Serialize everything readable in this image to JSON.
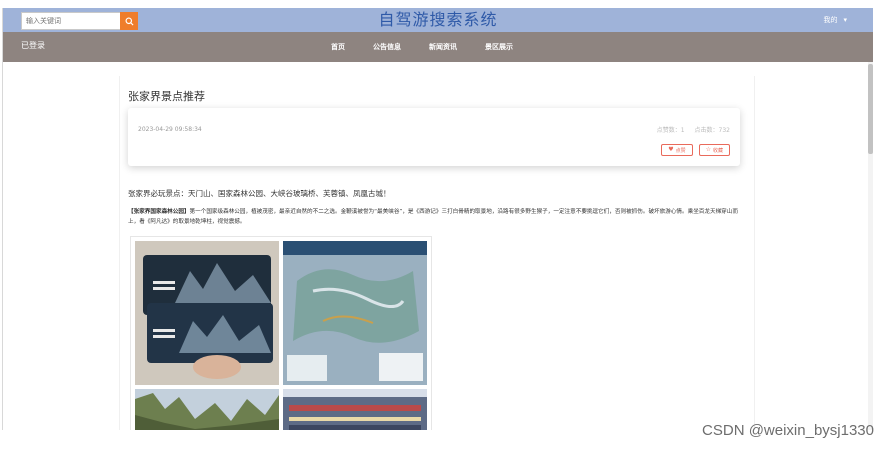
{
  "search": {
    "placeholder": "输入关键词"
  },
  "site_title": "自驾游搜索系统",
  "user_menu": {
    "label": "我的",
    "caret": "▾"
  },
  "logo": "已登录",
  "nav": [
    "首页",
    "公告信息",
    "新闻资讯",
    "景区展示"
  ],
  "article": {
    "title": "张家界景点推荐",
    "pub_time": "2023-04-29 09:58:34",
    "stats": {
      "likes": "点赞数：1",
      "views": "点击数：732"
    },
    "buttons": {
      "like": "点赞",
      "collect": "收藏"
    },
    "intro": "张家界必玩景点：天门山、国家森林公园、大峡谷玻璃桥、芙蓉镇、凤凰古城！",
    "para_bold": "【张家界国家森林公园】",
    "para_text": "第一个国家级森林公园，植被茂密，最亲近自然的不二之选。金鞭溪被誉为“最美峡谷”，是《西游记》三打白骨精的取景地，沿路有很多野生猴子，一定注意不要挑逗它们，否则被抓伤。破坏旅游心情。乘坐百龙天梯穿山而上，看《阿凡达》的取景地乾坤柱，视觉震撼。"
  },
  "watermark": "CSDN @weixin_bysj1330",
  "colors": {
    "topbar": "#9fb3d9",
    "navbar": "#8e8480",
    "accent": "#ef7d2b",
    "title": "#2f5aa8",
    "button": "#e96a5b"
  },
  "icons": {
    "search": "search-icon",
    "like": "heart-icon",
    "collect": "star-icon"
  }
}
